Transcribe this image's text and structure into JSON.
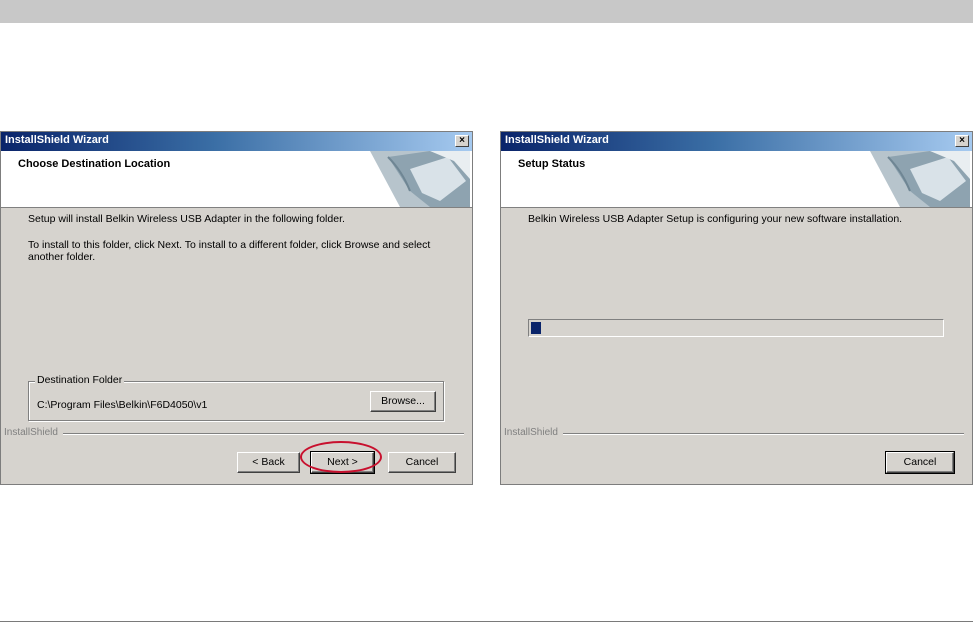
{
  "left_dialog": {
    "title": "InstallShield Wizard",
    "close_glyph": "×",
    "header_title": "Choose Destination Location",
    "text1": "Setup will install Belkin Wireless USB Adapter in the following folder.",
    "text2_line1": "To install to this folder, click Next. To install to a different folder, click Browse and select",
    "text2_line2": "another folder.",
    "group_label": "Destination Folder",
    "folder_path": "C:\\Program Files\\Belkin\\F6D4050\\v1",
    "browse_label": "Browse...",
    "brand": "InstallShield",
    "back_label": "< Back",
    "next_label": "Next >",
    "cancel_label": "Cancel",
    "highlight_color": "#c8102e"
  },
  "right_dialog": {
    "title": "InstallShield Wizard",
    "close_glyph": "×",
    "header_title": "Setup Status",
    "status_text": "Belkin Wireless USB Adapter Setup is configuring your new software installation.",
    "progress_fraction": 0.025,
    "brand": "InstallShield",
    "cancel_label": "Cancel"
  },
  "colors": {
    "titlebar_start": "#0a246a",
    "dialog_bg": "#d6d3ce",
    "progress_fill": "#0a246a"
  },
  "icons": {
    "header_graphic": "page-curl-graphic",
    "close": "close-icon"
  }
}
